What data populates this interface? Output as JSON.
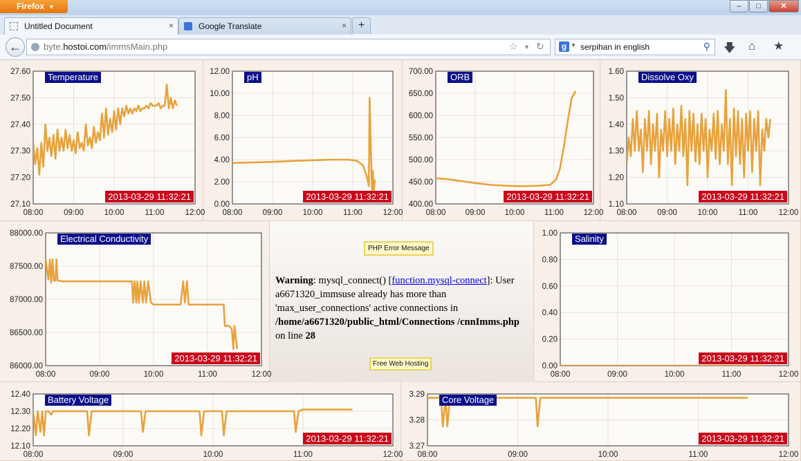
{
  "browser": {
    "app_button": "Firefox",
    "window_buttons": {
      "minimize": "–",
      "maximize": "□",
      "close": "✕"
    },
    "tabs": [
      {
        "label": "Untitled Document",
        "close": "×",
        "active": true
      },
      {
        "label": "Google Translate",
        "close": "×",
        "active": false
      }
    ],
    "new_tab": "+",
    "back": "←",
    "url_prefix": "byte.",
    "url_host": "hostoi.com",
    "url_path": "/immsMain.php",
    "search_engine_letter": "g",
    "search_query": "serpihan in english",
    "icons": [
      "firefox-icon",
      "back-arrow-icon",
      "globe-icon",
      "bookmark-star-icon",
      "reload-icon",
      "google-icon",
      "magnifier-icon",
      "download-arrow-icon",
      "home-icon",
      "bookmarks-menu-icon"
    ]
  },
  "error_panel": {
    "error_button": "PHP Error Message",
    "warning_label": "Warning",
    "msg_part1": ": mysql_connect() [",
    "link_text": "function.mysql-connect",
    "msg_part2": "]: User a6671320_immsuse already has more than 'max_user_connections' active connections in",
    "path": "/home/a6671320/public_html/Connections /cnnImms.php",
    "on_line": " on line ",
    "line_number": "28",
    "hosting_button": "Free Web Hosting"
  },
  "colors": {
    "line": "#e8a23c",
    "title_bg": "#0c0f8a",
    "stamp_bg": "#c8091c",
    "plot_bg": "#fdfbf7"
  },
  "chart_data": [
    {
      "type": "line",
      "title": "Temperature",
      "timestamp": "2013-03-29 11:32:21",
      "xlim": [
        8,
        12
      ],
      "ylim": [
        27.1,
        27.6
      ],
      "yticks": [
        "27.10",
        "27.20",
        "27.30",
        "27.40",
        "27.50",
        "27.60"
      ],
      "xticks": [
        "08:00",
        "09:00",
        "10:00",
        "11:00",
        "12:00"
      ],
      "x": [
        8.0,
        8.05,
        8.1,
        8.15,
        8.2,
        8.25,
        8.3,
        8.35,
        8.4,
        8.45,
        8.5,
        8.55,
        8.6,
        8.65,
        8.7,
        8.75,
        8.8,
        8.85,
        8.9,
        8.95,
        9.0,
        9.05,
        9.1,
        9.15,
        9.2,
        9.25,
        9.3,
        9.35,
        9.4,
        9.45,
        9.5,
        9.55,
        9.6,
        9.65,
        9.7,
        9.75,
        9.8,
        9.85,
        9.9,
        9.95,
        10.0,
        10.05,
        10.1,
        10.15,
        10.2,
        10.25,
        10.3,
        10.35,
        10.4,
        10.45,
        10.5,
        10.55,
        10.6,
        10.65,
        10.7,
        10.75,
        10.8,
        10.85,
        10.9,
        10.95,
        11.0,
        11.05,
        11.1,
        11.15,
        11.2,
        11.25,
        11.3,
        11.35,
        11.4,
        11.45,
        11.5,
        11.55
      ],
      "y": [
        27.33,
        27.25,
        27.31,
        27.21,
        27.33,
        27.24,
        27.4,
        27.3,
        27.35,
        27.28,
        27.36,
        27.27,
        27.38,
        27.3,
        27.35,
        27.3,
        27.38,
        27.31,
        27.36,
        27.3,
        27.34,
        27.29,
        27.37,
        27.31,
        27.33,
        27.3,
        27.4,
        27.32,
        27.35,
        27.31,
        27.39,
        27.33,
        27.37,
        27.34,
        27.44,
        27.35,
        27.46,
        27.36,
        27.42,
        27.37,
        27.45,
        27.38,
        27.46,
        27.4,
        27.46,
        27.43,
        27.47,
        27.44,
        27.46,
        27.44,
        27.46,
        27.45,
        27.47,
        27.45,
        27.46,
        27.46,
        27.47,
        27.46,
        27.48,
        27.47,
        27.47,
        27.47,
        27.48,
        27.46,
        27.47,
        27.47,
        27.55,
        27.46,
        27.5,
        27.46,
        27.49,
        27.47
      ]
    },
    {
      "type": "line",
      "title": "pH",
      "timestamp": "2013-03-29 11:32:21",
      "xlim": [
        8,
        12
      ],
      "ylim": [
        0,
        12
      ],
      "yticks": [
        "0.00",
        "2.00",
        "4.00",
        "6.00",
        "8.00",
        "10.00",
        "12.00"
      ],
      "xticks": [
        "08:00",
        "09:00",
        "10:00",
        "11:00",
        "12:00"
      ],
      "x": [
        8.0,
        8.5,
        9.0,
        9.5,
        10.0,
        10.5,
        10.9,
        11.1,
        11.25,
        11.35,
        11.4,
        11.42,
        11.45,
        11.48,
        11.5,
        11.52,
        11.55
      ],
      "y": [
        3.7,
        3.75,
        3.8,
        3.88,
        3.95,
        4.0,
        4.0,
        3.9,
        3.5,
        2.5,
        1.6,
        9.6,
        5.0,
        1.2,
        3.0,
        1.0,
        2.2
      ]
    },
    {
      "type": "line",
      "title": "ORB",
      "timestamp": "2013-03-29 11:32:21",
      "xlim": [
        8,
        12
      ],
      "ylim": [
        400,
        700
      ],
      "yticks": [
        "400.00",
        "450.00",
        "500.00",
        "550.00",
        "600.00",
        "650.00",
        "700.00"
      ],
      "xticks": [
        "08:00",
        "09:00",
        "10:00",
        "11:00",
        "12:00"
      ],
      "x": [
        8.0,
        8.3,
        8.6,
        9.0,
        9.4,
        9.8,
        10.2,
        10.6,
        10.9,
        11.05,
        11.15,
        11.25,
        11.35,
        11.45,
        11.55
      ],
      "y": [
        458,
        456,
        452,
        447,
        443,
        441,
        440,
        441,
        443,
        455,
        480,
        530,
        590,
        640,
        655
      ]
    },
    {
      "type": "line",
      "title": "Dissolve Oxy",
      "timestamp": "2013-03-29 11:32:21",
      "xlim": [
        8,
        12
      ],
      "ylim": [
        1.1,
        1.6
      ],
      "yticks": [
        "1.10",
        "1.20",
        "1.30",
        "1.40",
        "1.50",
        "1.60"
      ],
      "xticks": [
        "08:00",
        "09:00",
        "10:00",
        "11:00",
        "12:00"
      ],
      "x": [
        8.0,
        8.05,
        8.1,
        8.15,
        8.2,
        8.25,
        8.3,
        8.35,
        8.4,
        8.45,
        8.5,
        8.55,
        8.6,
        8.65,
        8.7,
        8.75,
        8.8,
        8.85,
        8.9,
        8.95,
        9.0,
        9.05,
        9.1,
        9.15,
        9.2,
        9.25,
        9.3,
        9.35,
        9.4,
        9.45,
        9.5,
        9.55,
        9.6,
        9.65,
        9.7,
        9.75,
        9.8,
        9.85,
        9.9,
        9.95,
        10.0,
        10.05,
        10.1,
        10.15,
        10.2,
        10.25,
        10.3,
        10.35,
        10.4,
        10.45,
        10.5,
        10.55,
        10.6,
        10.65,
        10.7,
        10.75,
        10.8,
        10.85,
        10.9,
        10.95,
        11.0,
        11.05,
        11.1,
        11.15,
        11.2,
        11.25,
        11.3,
        11.35,
        11.4,
        11.45,
        11.5,
        11.55
      ],
      "y": [
        1.25,
        1.35,
        1.28,
        1.42,
        1.3,
        1.45,
        1.3,
        1.38,
        1.22,
        1.42,
        1.3,
        1.45,
        1.25,
        1.4,
        1.3,
        1.44,
        1.2,
        1.38,
        1.3,
        1.45,
        1.28,
        1.42,
        1.3,
        1.46,
        1.25,
        1.4,
        1.3,
        1.47,
        1.28,
        1.42,
        1.17,
        1.45,
        1.3,
        1.44,
        1.26,
        1.4,
        1.25,
        1.44,
        1.3,
        1.42,
        1.2,
        1.38,
        1.3,
        1.44,
        1.27,
        1.45,
        1.25,
        1.4,
        1.3,
        1.53,
        1.25,
        1.42,
        1.17,
        1.46,
        1.28,
        1.45,
        1.25,
        1.42,
        1.2,
        1.44,
        1.3,
        1.45,
        1.22,
        1.42,
        1.3,
        1.45,
        1.17,
        1.38,
        1.3,
        1.42,
        1.35,
        1.42
      ]
    },
    {
      "type": "line",
      "title": "Electrical Conductivity",
      "timestamp": "2013-03-29 11:32:21",
      "xlim": [
        8,
        12
      ],
      "ylim": [
        86000,
        88000
      ],
      "yticks": [
        "86000.00",
        "86500.00",
        "87000.00",
        "87500.00",
        "88000.00"
      ],
      "xticks": [
        "08:00",
        "09:00",
        "10:00",
        "11:00",
        "12:00"
      ],
      "x": [
        8.0,
        8.05,
        8.08,
        8.1,
        8.13,
        8.15,
        8.18,
        8.2,
        8.22,
        8.25,
        8.3,
        9.0,
        9.6,
        9.62,
        9.65,
        9.68,
        9.7,
        9.73,
        9.76,
        9.8,
        9.83,
        9.86,
        9.9,
        9.95,
        10.0,
        10.5,
        10.55,
        10.58,
        10.62,
        10.65,
        10.7,
        10.75,
        11.0,
        11.3,
        11.32,
        11.35,
        11.4,
        11.45,
        11.48,
        11.5,
        11.55
      ],
      "y": [
        87600,
        87300,
        87600,
        87250,
        87600,
        87280,
        87280,
        87600,
        87280,
        87280,
        87270,
        87270,
        87270,
        86950,
        87270,
        86950,
        87270,
        86950,
        87270,
        86950,
        87270,
        86950,
        87270,
        86950,
        86920,
        86920,
        87270,
        86950,
        87270,
        86920,
        86920,
        86920,
        86920,
        86920,
        86600,
        86600,
        86600,
        86550,
        86250,
        86600,
        86250
      ]
    },
    {
      "type": "line",
      "title": "Salinity",
      "timestamp": "2013-03-29 11:32:21",
      "xlim": [
        8,
        12
      ],
      "ylim": [
        0,
        1
      ],
      "yticks": [
        "0.00",
        "0.20",
        "0.40",
        "0.60",
        "0.80",
        "1.00"
      ],
      "xticks": [
        "08:00",
        "09:00",
        "10:00",
        "11:00",
        "12:00"
      ],
      "x": [
        8.0,
        11.55
      ],
      "y": [
        0.0,
        0.0
      ]
    },
    {
      "type": "line",
      "title": "Battery Voltage",
      "timestamp": "2013-03-29 11:32:21",
      "xlim": [
        8,
        12
      ],
      "ylim": [
        12.1,
        12.4
      ],
      "yticks": [
        "12.10",
        "12.20",
        "12.30",
        "12.40"
      ],
      "xticks": [
        "08:00",
        "09:00",
        "10:00",
        "11:00",
        "12:00"
      ],
      "x": [
        8.0,
        8.03,
        8.05,
        8.08,
        8.1,
        8.12,
        8.14,
        8.17,
        8.2,
        8.22,
        8.25,
        8.5,
        8.6,
        8.62,
        8.65,
        9.0,
        9.2,
        9.22,
        9.25,
        9.7,
        9.85,
        9.87,
        9.9,
        10.1,
        10.12,
        10.15,
        10.5,
        10.9,
        10.92,
        10.95,
        11.0,
        11.5,
        11.55
      ],
      "y": [
        12.3,
        12.16,
        12.3,
        12.18,
        12.3,
        12.16,
        12.3,
        12.3,
        12.28,
        12.3,
        12.3,
        12.3,
        12.3,
        12.16,
        12.3,
        12.3,
        12.3,
        12.18,
        12.3,
        12.3,
        12.3,
        12.16,
        12.3,
        12.3,
        12.16,
        12.3,
        12.3,
        12.3,
        12.18,
        12.3,
        12.31,
        12.31,
        12.31
      ]
    },
    {
      "type": "line",
      "title": "Core Voltage",
      "timestamp": "2013-03-29 11:32:21",
      "xlim": [
        8,
        12
      ],
      "ylim": [
        3.27,
        3.29
      ],
      "yticks": [
        "3.27",
        "3.28",
        "3.29"
      ],
      "xticks": [
        "08:00",
        "09:00",
        "10:00",
        "11:00",
        "12:00"
      ],
      "x": [
        8.0,
        8.15,
        8.17,
        8.2,
        8.22,
        8.25,
        8.3,
        8.7,
        9.2,
        9.22,
        9.25,
        9.8,
        10.5,
        11.0,
        11.55
      ],
      "y": [
        3.2885,
        3.2885,
        3.2775,
        3.2885,
        3.2775,
        3.2885,
        3.2885,
        3.2885,
        3.2885,
        3.2775,
        3.2885,
        3.2885,
        3.2885,
        3.2885,
        3.2885
      ]
    }
  ]
}
